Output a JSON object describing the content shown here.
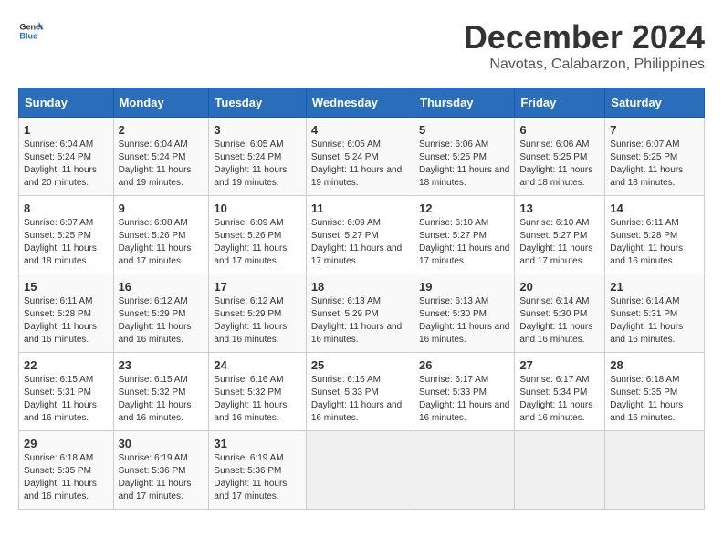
{
  "logo": {
    "general": "General",
    "blue": "Blue"
  },
  "title": "December 2024",
  "subtitle": "Navotas, Calabarzon, Philippines",
  "headers": [
    "Sunday",
    "Monday",
    "Tuesday",
    "Wednesday",
    "Thursday",
    "Friday",
    "Saturday"
  ],
  "weeks": [
    [
      {
        "day": "1",
        "sunrise": "6:04 AM",
        "sunset": "5:24 PM",
        "daylight": "11 hours and 20 minutes."
      },
      {
        "day": "2",
        "sunrise": "6:04 AM",
        "sunset": "5:24 PM",
        "daylight": "11 hours and 19 minutes."
      },
      {
        "day": "3",
        "sunrise": "6:05 AM",
        "sunset": "5:24 PM",
        "daylight": "11 hours and 19 minutes."
      },
      {
        "day": "4",
        "sunrise": "6:05 AM",
        "sunset": "5:24 PM",
        "daylight": "11 hours and 19 minutes."
      },
      {
        "day": "5",
        "sunrise": "6:06 AM",
        "sunset": "5:25 PM",
        "daylight": "11 hours and 18 minutes."
      },
      {
        "day": "6",
        "sunrise": "6:06 AM",
        "sunset": "5:25 PM",
        "daylight": "11 hours and 18 minutes."
      },
      {
        "day": "7",
        "sunrise": "6:07 AM",
        "sunset": "5:25 PM",
        "daylight": "11 hours and 18 minutes."
      }
    ],
    [
      {
        "day": "8",
        "sunrise": "6:07 AM",
        "sunset": "5:25 PM",
        "daylight": "11 hours and 18 minutes."
      },
      {
        "day": "9",
        "sunrise": "6:08 AM",
        "sunset": "5:26 PM",
        "daylight": "11 hours and 17 minutes."
      },
      {
        "day": "10",
        "sunrise": "6:09 AM",
        "sunset": "5:26 PM",
        "daylight": "11 hours and 17 minutes."
      },
      {
        "day": "11",
        "sunrise": "6:09 AM",
        "sunset": "5:27 PM",
        "daylight": "11 hours and 17 minutes."
      },
      {
        "day": "12",
        "sunrise": "6:10 AM",
        "sunset": "5:27 PM",
        "daylight": "11 hours and 17 minutes."
      },
      {
        "day": "13",
        "sunrise": "6:10 AM",
        "sunset": "5:27 PM",
        "daylight": "11 hours and 17 minutes."
      },
      {
        "day": "14",
        "sunrise": "6:11 AM",
        "sunset": "5:28 PM",
        "daylight": "11 hours and 16 minutes."
      }
    ],
    [
      {
        "day": "15",
        "sunrise": "6:11 AM",
        "sunset": "5:28 PM",
        "daylight": "11 hours and 16 minutes."
      },
      {
        "day": "16",
        "sunrise": "6:12 AM",
        "sunset": "5:29 PM",
        "daylight": "11 hours and 16 minutes."
      },
      {
        "day": "17",
        "sunrise": "6:12 AM",
        "sunset": "5:29 PM",
        "daylight": "11 hours and 16 minutes."
      },
      {
        "day": "18",
        "sunrise": "6:13 AM",
        "sunset": "5:29 PM",
        "daylight": "11 hours and 16 minutes."
      },
      {
        "day": "19",
        "sunrise": "6:13 AM",
        "sunset": "5:30 PM",
        "daylight": "11 hours and 16 minutes."
      },
      {
        "day": "20",
        "sunrise": "6:14 AM",
        "sunset": "5:30 PM",
        "daylight": "11 hours and 16 minutes."
      },
      {
        "day": "21",
        "sunrise": "6:14 AM",
        "sunset": "5:31 PM",
        "daylight": "11 hours and 16 minutes."
      }
    ],
    [
      {
        "day": "22",
        "sunrise": "6:15 AM",
        "sunset": "5:31 PM",
        "daylight": "11 hours and 16 minutes."
      },
      {
        "day": "23",
        "sunrise": "6:15 AM",
        "sunset": "5:32 PM",
        "daylight": "11 hours and 16 minutes."
      },
      {
        "day": "24",
        "sunrise": "6:16 AM",
        "sunset": "5:32 PM",
        "daylight": "11 hours and 16 minutes."
      },
      {
        "day": "25",
        "sunrise": "6:16 AM",
        "sunset": "5:33 PM",
        "daylight": "11 hours and 16 minutes."
      },
      {
        "day": "26",
        "sunrise": "6:17 AM",
        "sunset": "5:33 PM",
        "daylight": "11 hours and 16 minutes."
      },
      {
        "day": "27",
        "sunrise": "6:17 AM",
        "sunset": "5:34 PM",
        "daylight": "11 hours and 16 minutes."
      },
      {
        "day": "28",
        "sunrise": "6:18 AM",
        "sunset": "5:35 PM",
        "daylight": "11 hours and 16 minutes."
      }
    ],
    [
      {
        "day": "29",
        "sunrise": "6:18 AM",
        "sunset": "5:35 PM",
        "daylight": "11 hours and 16 minutes."
      },
      {
        "day": "30",
        "sunrise": "6:19 AM",
        "sunset": "5:36 PM",
        "daylight": "11 hours and 17 minutes."
      },
      {
        "day": "31",
        "sunrise": "6:19 AM",
        "sunset": "5:36 PM",
        "daylight": "11 hours and 17 minutes."
      },
      null,
      null,
      null,
      null
    ]
  ],
  "labels": {
    "sunrise_prefix": "Sunrise: ",
    "sunset_prefix": "Sunset: ",
    "daylight_prefix": "Daylight: "
  }
}
